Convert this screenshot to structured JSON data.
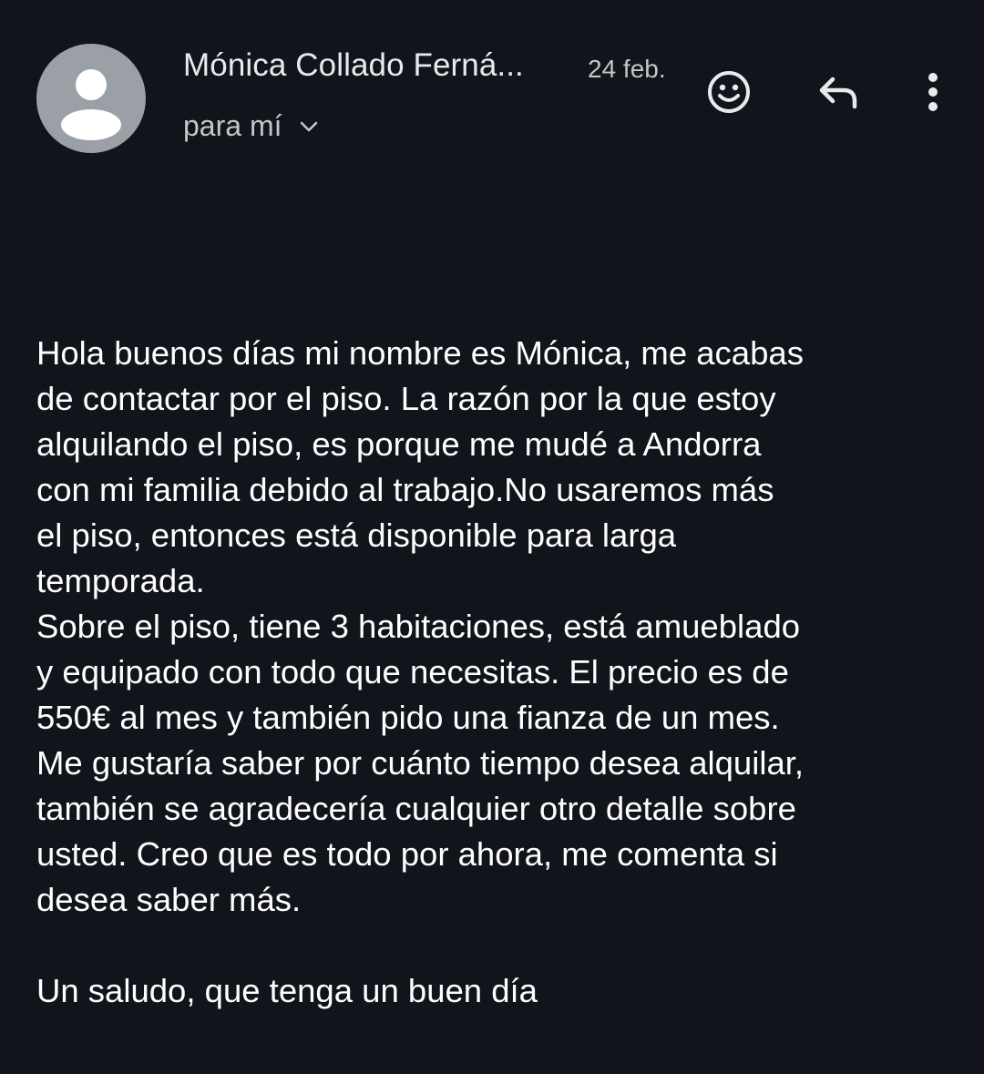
{
  "header": {
    "sender_name": "Mónica Collado Ferná...",
    "date": "24 feb.",
    "recipient_label": "para mí",
    "avatar_icon": "person-icon",
    "actions": [
      {
        "name": "emoji-reaction",
        "icon": "smiley-icon"
      },
      {
        "name": "reply",
        "icon": "reply-arrow-icon"
      },
      {
        "name": "more-options",
        "icon": "vertical-dots-icon"
      }
    ]
  },
  "message": {
    "paragraphs": [
      "Hola buenos días mi nombre es Mónica, me acabas\nde contactar por el piso. La razón por la que estoy\nalquilando el piso, es porque me mudé a Andorra\ncon mi familia debido al trabajo.No usaremos más\nel piso, entonces está disponible para larga\ntemporada.",
      "Sobre el piso, tiene 3 habitaciones, está amueblado\ny equipado con todo que necesitas. El precio es de\n550€ al mes y también pido una fianza de un mes.\nMe gustaría saber por cuánto tiempo desea alquilar,\ntambién se agradecería cualquier otro detalle sobre\nusted. Creo que es todo por ahora, me comenta si\ndesea saber más."
    ],
    "signoff": "Un saludo, que tenga un buen día"
  },
  "colors": {
    "background": "#11141a",
    "avatar": "#9aa0a6",
    "primary_text": "#ffffff",
    "secondary_text": "#c4c7c5"
  }
}
